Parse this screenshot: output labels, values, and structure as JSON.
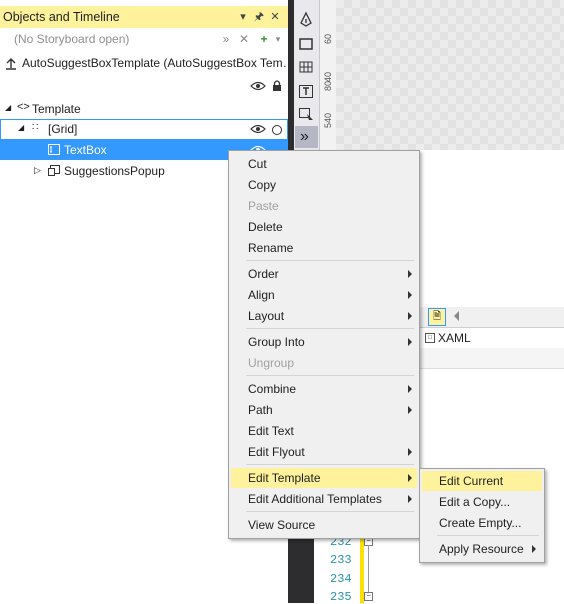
{
  "panel": {
    "title": "Objects and Timeline",
    "storyboard_placeholder": "(No Storyboard open)",
    "template_label": "AutoSuggestBoxTemplate (AutoSuggestBox Tem…",
    "tree": {
      "template": "Template",
      "grid": "[Grid]",
      "textbox": "TextBox",
      "popup": "SuggestionsPopup"
    }
  },
  "ruler": {
    "ticks": [
      "60",
      "40",
      "80",
      "540"
    ]
  },
  "editor": {
    "tab_label": "XAML",
    "line_numbers": [
      "232",
      "233",
      "234",
      "235"
    ]
  },
  "context_menu": {
    "items": [
      {
        "label": "Cut"
      },
      {
        "label": "Copy"
      },
      {
        "label": "Paste"
      },
      {
        "label": "Delete"
      },
      {
        "label": "Rename"
      },
      {
        "label": "Order"
      },
      {
        "label": "Align"
      },
      {
        "label": "Layout"
      },
      {
        "label": "Group Into"
      },
      {
        "label": "Ungroup"
      },
      {
        "label": "Combine"
      },
      {
        "label": "Path"
      },
      {
        "label": "Edit Text"
      },
      {
        "label": "Edit Flyout"
      },
      {
        "label": "Edit Template"
      },
      {
        "label": "Edit Additional Templates"
      },
      {
        "label": "View Source"
      }
    ]
  },
  "submenu": {
    "items": [
      {
        "label": "Edit Current"
      },
      {
        "label": "Edit a Copy..."
      },
      {
        "label": "Create Empty..."
      },
      {
        "label": "Apply Resource"
      }
    ]
  },
  "colors": {
    "highlight": "#fff29d",
    "selection": "#3399ff"
  }
}
